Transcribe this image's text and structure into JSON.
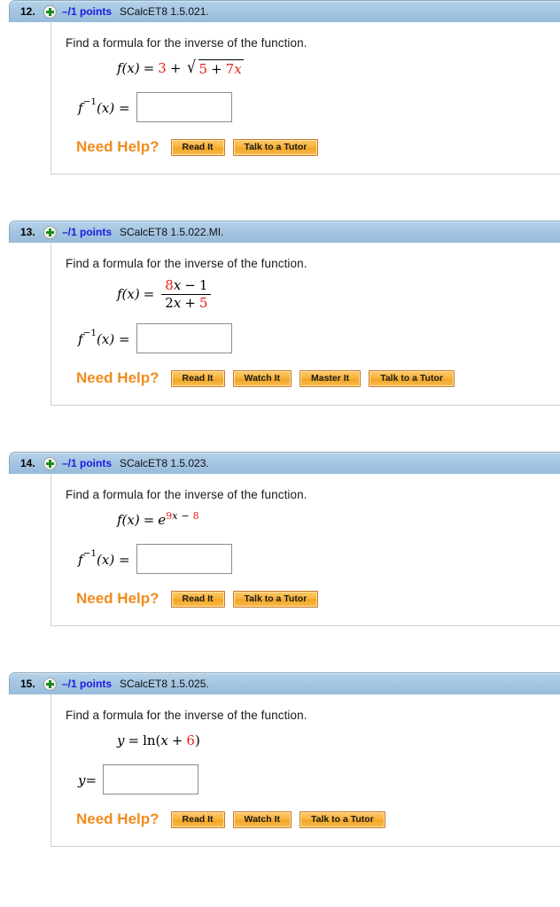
{
  "colors": {
    "header_bg": "#a6c6e2",
    "points_text": "#1a1ae0",
    "constant_red": "#e8201a",
    "need_help_orange": "#f08b1d",
    "button_orange": "#f8b43c"
  },
  "labels": {
    "plus_icon": "plus-icon",
    "need_help": "Need Help?",
    "prompt_inverse": "Find a formula for the inverse of the function."
  },
  "buttons": {
    "read_it": "Read It",
    "watch_it": "Watch It",
    "master_it": "Master It",
    "talk_to_a_tutor": "Talk to a Tutor"
  },
  "problems": [
    {
      "number": "12.",
      "points": "–/1 points",
      "code": "SCalcET8 1.5.021.",
      "prompt": "Find a formula for the inverse of the function.",
      "answer_label_main": "f",
      "answer_label_exp": "−1",
      "answer_label_rest": "(x) =",
      "answer_value": "",
      "formula": {
        "lhs": "f(x)",
        "eq": "=",
        "a": "3",
        "plus": "+",
        "radicand_a": "5",
        "radicand_op": "+",
        "radicand_b": "7",
        "radicand_var": "x"
      },
      "help_buttons": [
        "Read It",
        "Talk to a Tutor"
      ]
    },
    {
      "number": "13.",
      "points": "–/1 points",
      "code": "SCalcET8 1.5.022.MI.",
      "prompt": "Find a formula for the inverse of the function.",
      "answer_label_main": "f",
      "answer_label_exp": "−1",
      "answer_label_rest": "(x) =",
      "answer_value": "",
      "formula": {
        "lhs": "f(x)",
        "eq": "=",
        "num_a": "8",
        "num_var": "x",
        "num_op": "−",
        "num_b": "1",
        "den_a": "2",
        "den_var": "x",
        "den_op": "+",
        "den_b": "5"
      },
      "help_buttons": [
        "Read It",
        "Watch It",
        "Master It",
        "Talk to a Tutor"
      ]
    },
    {
      "number": "14.",
      "points": "–/1 points",
      "code": "SCalcET8 1.5.023.",
      "prompt": "Find a formula for the inverse of the function.",
      "answer_label_main": "f",
      "answer_label_exp": "−1",
      "answer_label_rest": "(x) =",
      "answer_value": "",
      "formula": {
        "lhs": "f(x)",
        "eq": "=",
        "base": "e",
        "exp_a": "9",
        "exp_var": "x",
        "exp_op": "−",
        "exp_b": "8"
      },
      "help_buttons": [
        "Read It",
        "Talk to a Tutor"
      ]
    },
    {
      "number": "15.",
      "points": "–/1 points",
      "code": "SCalcET8 1.5.025.",
      "prompt": "Find a formula for the inverse of the function.",
      "answer_label_main": "y",
      "answer_label_exp": "",
      "answer_label_rest": "=",
      "answer_value": "",
      "formula": {
        "lhs": "y",
        "eq": "=",
        "fn": "ln(",
        "var": "x",
        "op": "+",
        "b": "6",
        "close": ")"
      },
      "help_buttons": [
        "Read It",
        "Watch It",
        "Talk to a Tutor"
      ]
    }
  ]
}
